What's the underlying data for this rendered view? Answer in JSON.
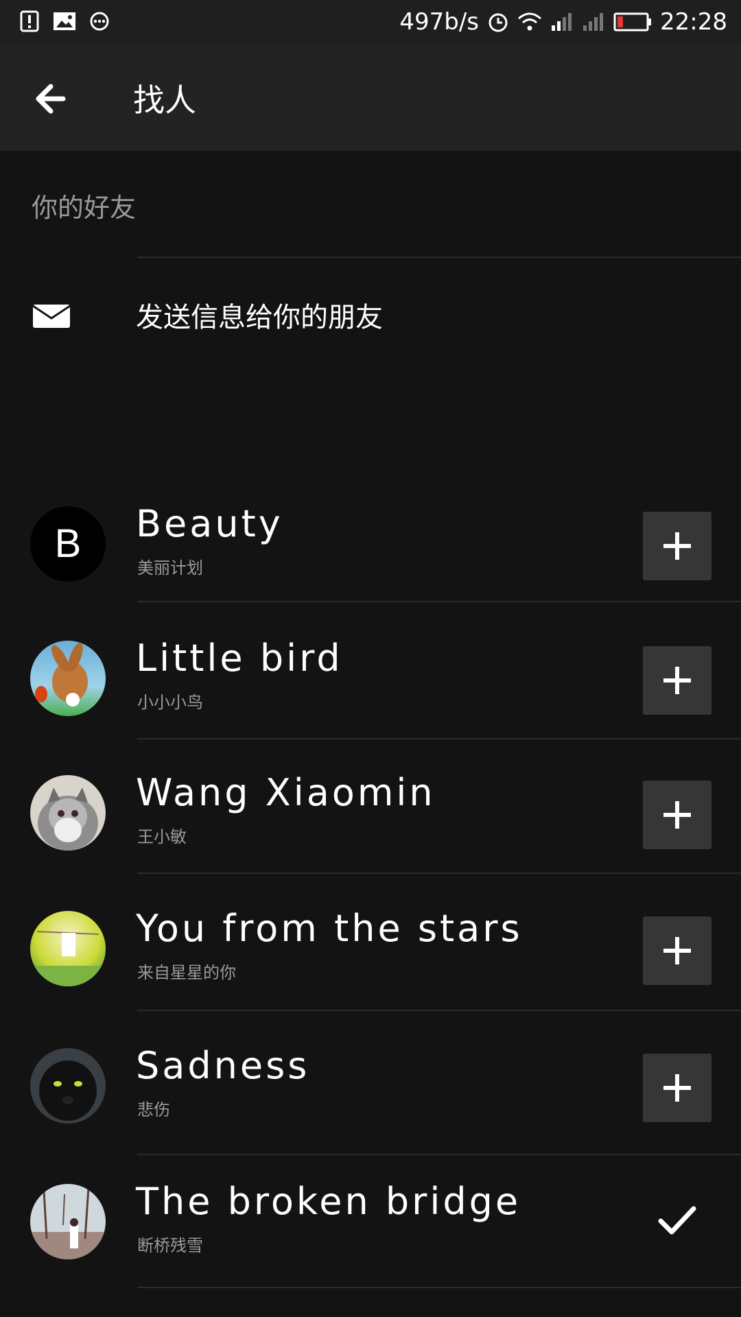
{
  "status_bar": {
    "speed": "497b/s",
    "time": "22:28",
    "icons": [
      "alert-icon",
      "image-icon",
      "more-icon",
      "alarm-icon",
      "wifi-icon",
      "signal-icon",
      "signal-icon-2",
      "battery-low-icon"
    ],
    "battery_color": "#e53935"
  },
  "app_bar": {
    "title": "找人",
    "back_icon": "arrow-back-icon"
  },
  "section_label": "你的好友",
  "invite": {
    "icon": "mail-icon",
    "label": "发送信息给你的朋友"
  },
  "friends": [
    {
      "name": "Beauty",
      "subtitle": "美丽计划",
      "avatar": "B",
      "action": "add"
    },
    {
      "name": "Little bird",
      "subtitle": "小小小鸟",
      "avatar": "rabbit-photo",
      "action": "add"
    },
    {
      "name": "Wang Xiaomin",
      "subtitle": "王小敏",
      "avatar": "cat-photo",
      "action": "add"
    },
    {
      "name": "You from the stars",
      "subtitle": "来自星星的你",
      "avatar": "field-photo",
      "action": "add"
    },
    {
      "name": "Sadness",
      "subtitle": "悲伤",
      "avatar": "panther-photo",
      "action": "add"
    },
    {
      "name": "The broken bridge",
      "subtitle": "断桥残雪",
      "avatar": "forest-photo",
      "action": "added"
    }
  ]
}
